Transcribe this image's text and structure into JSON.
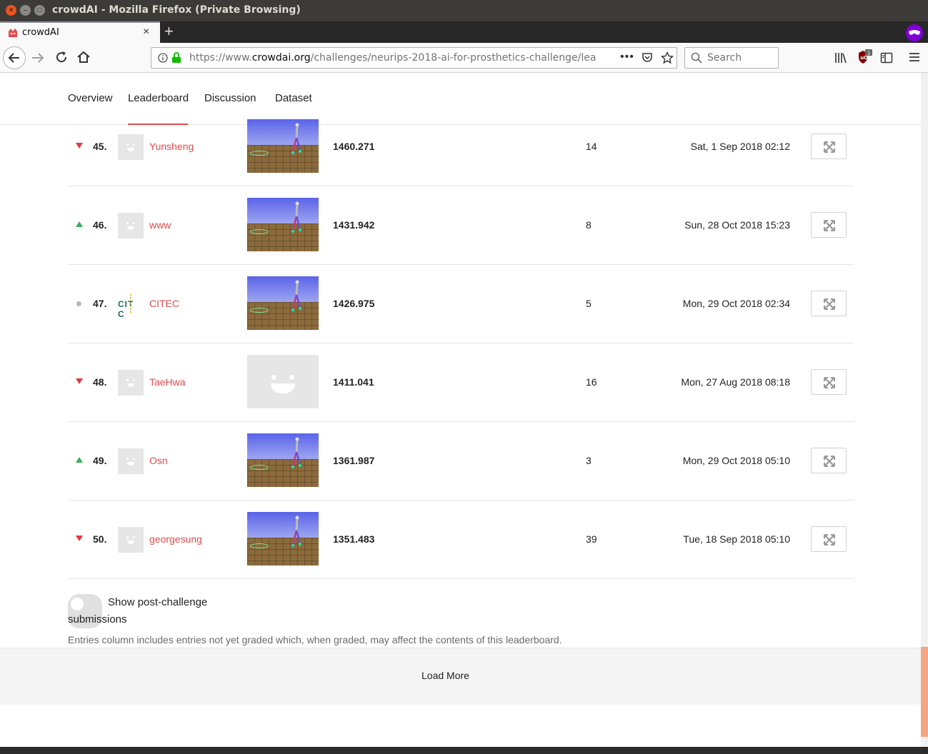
{
  "window": {
    "title": "crowdAI - Mozilla Firefox (Private Browsing)"
  },
  "tab": {
    "title": "crowdAI"
  },
  "urlbar": {
    "scheme": "https://www.",
    "host": "crowdai.org",
    "path": "/challenges/neurips-2018-ai-for-prosthetics-challenge/lea"
  },
  "search": {
    "placeholder": "Search"
  },
  "ublock_badge": "1",
  "subnav": {
    "tabs": [
      "Overview",
      "Leaderboard",
      "Discussion",
      "Dataset"
    ],
    "active": "Leaderboard"
  },
  "leaderboard": {
    "rows": [
      {
        "trend": "down",
        "rank": "45.",
        "user": "Yunsheng",
        "avatar": "default",
        "thumb": "video",
        "score": "1460.271",
        "entries": "14",
        "date": "Sat, 1 Sep 2018 02:12"
      },
      {
        "trend": "up",
        "rank": "46.",
        "user": "www",
        "avatar": "default",
        "thumb": "video",
        "score": "1431.942",
        "entries": "8",
        "date": "Sun, 28 Oct 2018 15:23"
      },
      {
        "trend": "same",
        "rank": "47.",
        "user": "CITEC",
        "avatar": "logo",
        "logo_text": "CIT C",
        "thumb": "video",
        "score": "1426.975",
        "entries": "5",
        "date": "Mon, 29 Oct 2018 02:34"
      },
      {
        "trend": "down",
        "rank": "48.",
        "user": "TaeHwa",
        "avatar": "default",
        "thumb": "placeholder",
        "score": "1411.041",
        "entries": "16",
        "date": "Mon, 27 Aug 2018 08:18"
      },
      {
        "trend": "up",
        "rank": "49.",
        "user": "Osn",
        "avatar": "default",
        "thumb": "video",
        "score": "1361.987",
        "entries": "3",
        "date": "Mon, 29 Oct 2018 05:10"
      },
      {
        "trend": "down",
        "rank": "50.",
        "user": "georgesung",
        "avatar": "default",
        "thumb": "video",
        "score": "1351.483",
        "entries": "39",
        "date": "Tue, 18 Sep 2018 05:10"
      }
    ]
  },
  "toggle": {
    "label": "Show post-challenge submissions",
    "checked": false
  },
  "note": "Entries column includes entries not yet graded which, when graded, may affect the contents of this leaderboard.",
  "load_more_label": "Load More",
  "colors": {
    "accent": "#e34b4b",
    "trend_up": "#3bb057",
    "trend_down": "#e03a3a",
    "trend_same": "#b8b8b8"
  }
}
